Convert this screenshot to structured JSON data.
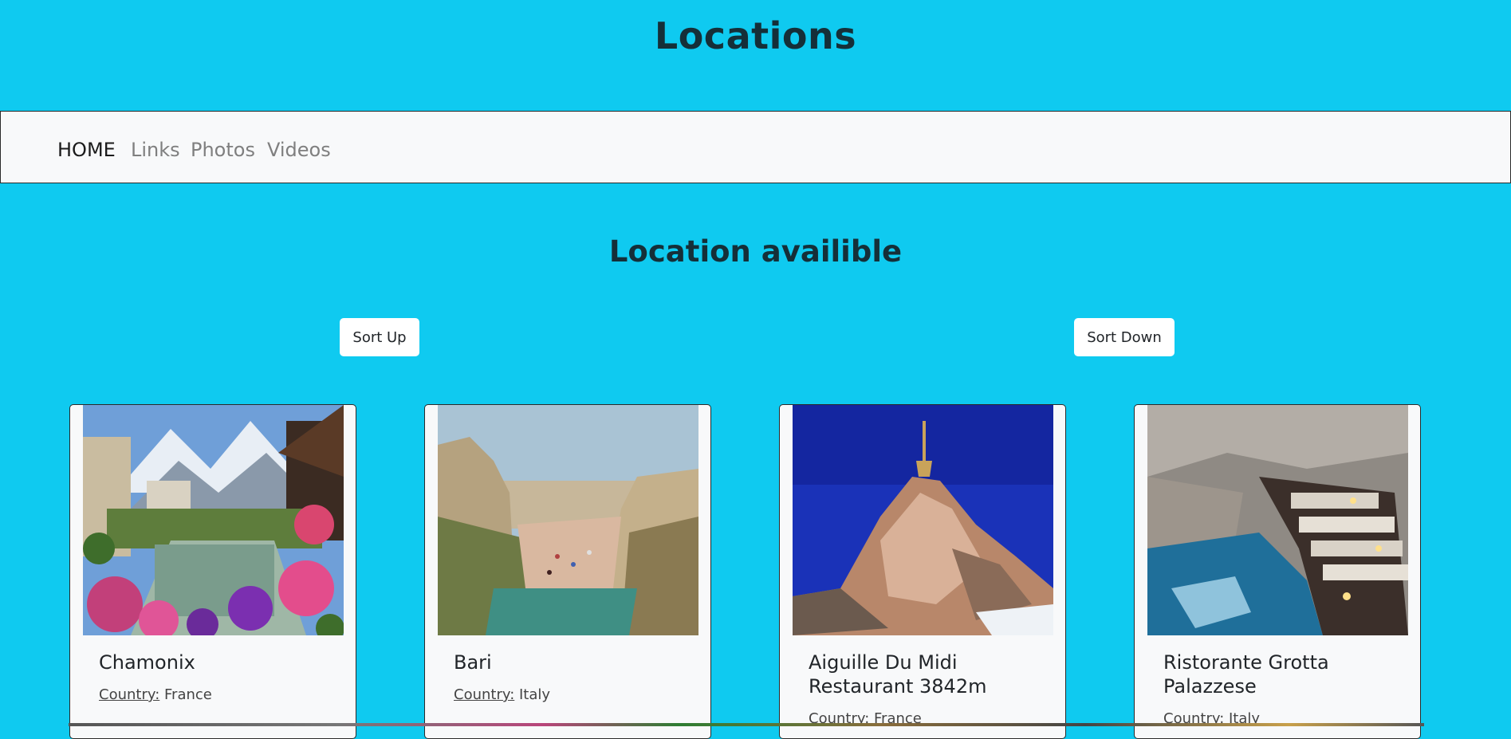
{
  "header": {
    "title": "Locations"
  },
  "nav": {
    "items": [
      {
        "label": "HOME",
        "active": true
      },
      {
        "label": "Links",
        "active": false
      },
      {
        "label": "Photos",
        "active": false
      },
      {
        "label": "Videos",
        "active": false
      }
    ]
  },
  "main": {
    "section_title": "Location availible",
    "sort_up_label": "Sort Up",
    "sort_down_label": "Sort Down",
    "country_label": "Country:",
    "cards": [
      {
        "title": "Chamonix",
        "country": "France",
        "image": "chamonix-flowers-river-mountains"
      },
      {
        "title": "Bari",
        "country": "Italy",
        "image": "bari-cliff-beach"
      },
      {
        "title": "Aiguille Du Midi Restaurant 3842m",
        "country": "France",
        "image": "aiguille-du-midi-peak"
      },
      {
        "title": "Ristorante Grotta Palazzese",
        "country": "Italy",
        "image": "grotta-palazzese-cave-restaurant"
      }
    ]
  },
  "colors": {
    "background": "#0fcaf0",
    "navbar": "#f8f9fa",
    "heading": "#152f38"
  }
}
